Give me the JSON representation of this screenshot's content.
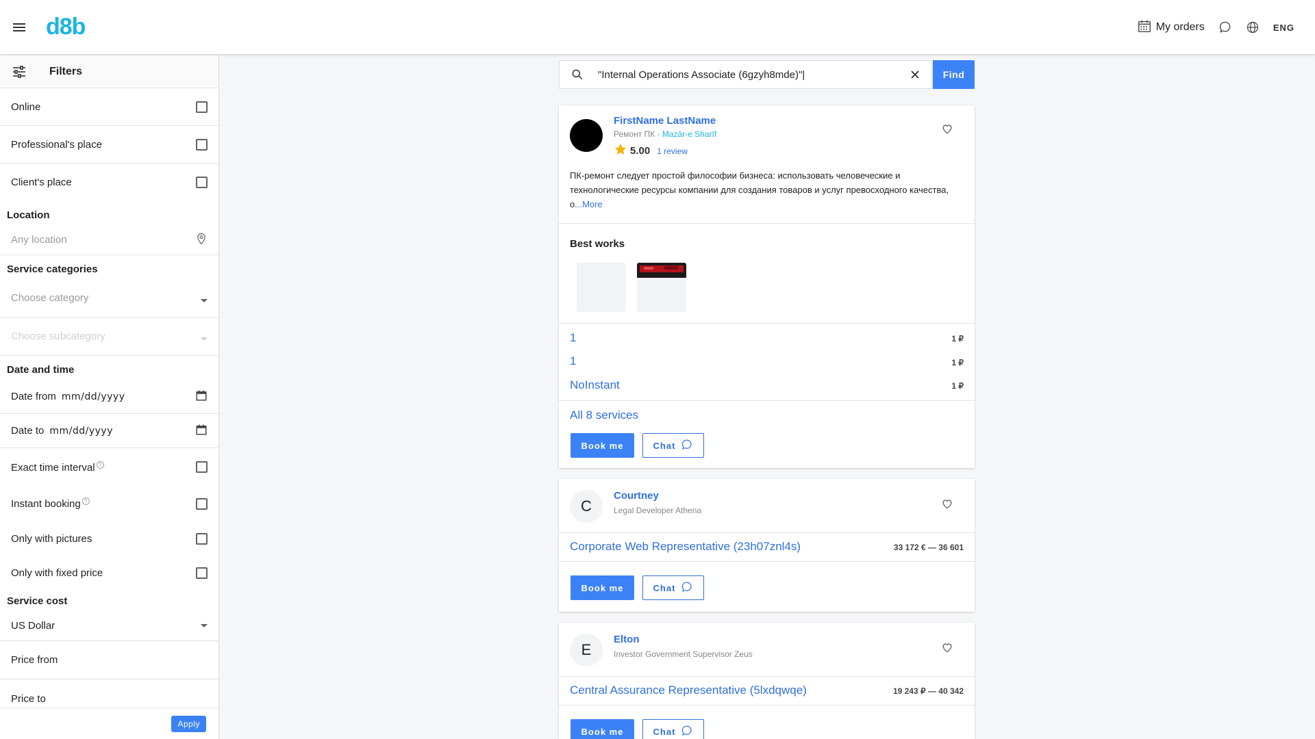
{
  "header": {
    "logo": "d8b",
    "my_orders": "My orders",
    "language": "ENG"
  },
  "sidebar": {
    "title": "Filters",
    "options": [
      {
        "label": "Online"
      },
      {
        "label": "Professional's place"
      },
      {
        "label": "Client's place"
      }
    ],
    "location": {
      "title": "Location",
      "placeholder": "Any location"
    },
    "categories": {
      "title": "Service categories",
      "category_placeholder": "Choose category",
      "subcategory_placeholder": "Choose subcategory"
    },
    "datetime": {
      "title": "Date and time",
      "from_label": "Date from",
      "from_value": "mm/dd/yyyy",
      "to_label": "Date to",
      "to_value": "mm/dd/yyyy"
    },
    "toggles": [
      {
        "label": "Exact time interval"
      },
      {
        "label": "Instant booking"
      },
      {
        "label": "Only with pictures"
      },
      {
        "label": "Only with fixed price"
      }
    ],
    "cost": {
      "title": "Service cost",
      "currency": "US Dollar",
      "price_from": "Price from",
      "price_to": "Price to"
    },
    "apply": "Apply"
  },
  "search": {
    "query": "\"Internal Operations Associate (6gzyh8mde)\"|",
    "find": "Find"
  },
  "cards": [
    {
      "name": "FirstName LastName",
      "subtitle": "Ремонт ПК · ",
      "location": "Mazār-e Sharīf",
      "rating": "5.00",
      "reviews": "1 review",
      "description": "ПК-ремонт следует простой философии бизнеса: использовать человеческие и технологические ресурсы компании для создания товаров и услуг превосходного качества, о",
      "more": "...More",
      "best_works": "Best works",
      "services": [
        {
          "name": "1",
          "price": "1 ₽"
        },
        {
          "name": "1",
          "price": "1 ₽"
        },
        {
          "name": "NoInstant",
          "price": "1 ₽"
        }
      ],
      "all_services": "All 8 services",
      "book": "Book me",
      "chat": "Chat"
    },
    {
      "initial": "C",
      "name": "Courtney",
      "subtitle": "Legal Developer Athena",
      "services": [
        {
          "name": "Corporate Web Representative (23h07znl4s)",
          "price": "33 172 € — 36 601"
        }
      ],
      "book": "Book me",
      "chat": "Chat"
    },
    {
      "initial": "E",
      "name": "Elton",
      "subtitle": "Investor Government Supervisor Zeus",
      "services": [
        {
          "name": "Central Assurance Representative (5lxdqwqe)",
          "price": "19 243 ₽ — 40 342"
        }
      ],
      "book": "Book me",
      "chat": "Chat"
    }
  ],
  "colors": {
    "brand": "#1bb5e0",
    "accent": "#3b82f6",
    "link": "#2f6fde",
    "star": "#f4b400"
  }
}
